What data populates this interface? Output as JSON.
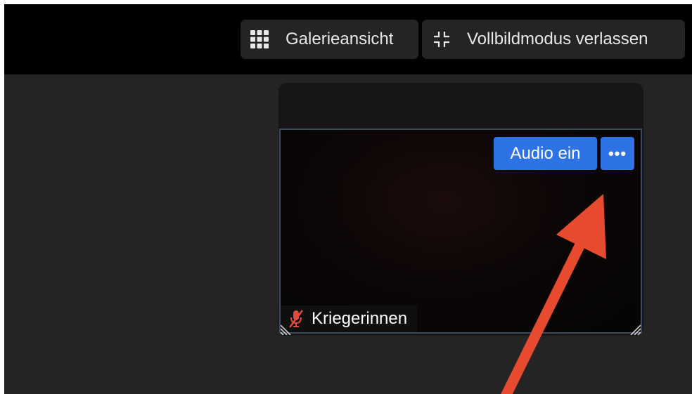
{
  "toolbar": {
    "gallery_label": "Galerieansicht",
    "fullscreen_exit_label": "Vollbildmodus verlassen"
  },
  "participant": {
    "name": "Kriegerinnen",
    "audio_button_label": "Audio ein",
    "more_button_label": "•••",
    "mic_state": "muted"
  },
  "icons": {
    "gallery": "grid-icon",
    "fullscreen_exit": "exit-fullscreen-icon",
    "mic": "mic-muted-icon",
    "resize": "resize-grip-icon"
  },
  "colors": {
    "accent": "#2d73e6",
    "annotation_arrow": "#e84a2f",
    "mic_muted": "#e04a3a",
    "tile_border": "#3e4a59"
  }
}
